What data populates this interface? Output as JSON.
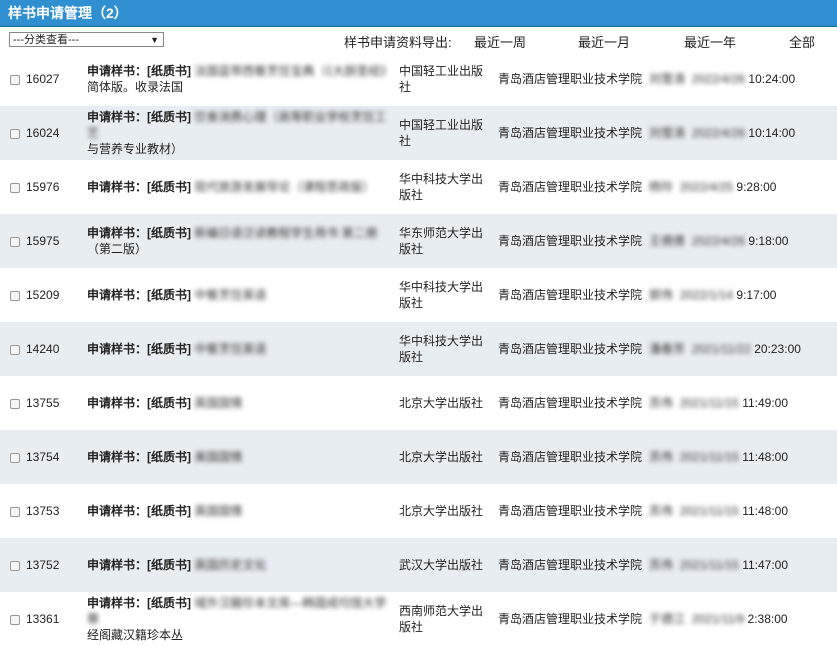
{
  "header": {
    "title": "样书申请管理（2）"
  },
  "toolbar": {
    "filter_value": "---分类查看---",
    "export_label": "样书申请资料导出:",
    "export_links": [
      "最近一周",
      "最近一月",
      "最近一年",
      "全部"
    ]
  },
  "rows": [
    {
      "id": "16027",
      "prefix": "申请样书：[纸质书]",
      "title": "法国蓝带西餐烹饪宝典（《大厨圣经》",
      "title2": "简体版。收录法国",
      "publisher": "中国轻工业出版社",
      "school": "青岛酒店管理职业技术学院",
      "person": "刘雪涛",
      "date": "2022/4/26",
      "time": "10:24:00"
    },
    {
      "id": "16024",
      "prefix": "申请样书：[纸质书]",
      "title": "饮食消费心理（高等职业学校烹饪工艺",
      "title2": "与营养专业教材）",
      "publisher": "中国轻工业出版社",
      "school": "青岛酒店管理职业技术学院",
      "person": "刘雪涛",
      "date": "2022/4/26",
      "time": "10:14:00"
    },
    {
      "id": "15976",
      "prefix": "申请样书：[纸质书]",
      "title": "现代旅游发展导论（课程思政版）",
      "title2": "",
      "publisher": "华中科技大学出版社",
      "school": "青岛酒店管理职业技术学院",
      "person": "杨玲",
      "date": "2022/4/25",
      "time": "9:28:00"
    },
    {
      "id": "15975",
      "prefix": "申请样书：[纸质书]",
      "title": "新编日语泛读教程学生用书 第二册",
      "title2": "（第二版）",
      "publisher": "华东师范大学出版社",
      "school": "青岛酒店管理职业技术学院",
      "person": "王倩倩",
      "date": "2022/4/26",
      "time": "9:18:00"
    },
    {
      "id": "15209",
      "prefix": "申请样书：[纸质书]",
      "title": "中餐烹饪英语",
      "title2": "",
      "publisher": "华中科技大学出版社",
      "school": "青岛酒店管理职业技术学院",
      "person": "郭伟",
      "date": "2022/1/14",
      "time": "9:17:00"
    },
    {
      "id": "14240",
      "prefix": "申请样书：[纸质书]",
      "title": "中餐烹饪英语",
      "title2": "",
      "publisher": "华中科技大学出版社",
      "school": "青岛酒店管理职业技术学院",
      "person": "潘春芳",
      "date": "2021/11/22",
      "time": "20:23:00"
    },
    {
      "id": "13755",
      "prefix": "申请样书：[纸质书]",
      "title": "英国国情",
      "title2": "",
      "publisher": "北京大学出版社",
      "school": "青岛酒店管理职业技术学院",
      "person": "苏伟",
      "date": "2021/11/15",
      "time": "11:49:00"
    },
    {
      "id": "13754",
      "prefix": "申请样书：[纸质书]",
      "title": "美国国情",
      "title2": "",
      "publisher": "北京大学出版社",
      "school": "青岛酒店管理职业技术学院",
      "person": "苏伟",
      "date": "2021/11/15",
      "time": "11:48:00"
    },
    {
      "id": "13753",
      "prefix": "申请样书：[纸质书]",
      "title": "英国国情",
      "title2": "",
      "publisher": "北京大学出版社",
      "school": "青岛酒店管理职业技术学院",
      "person": "苏伟",
      "date": "2021/11/15",
      "time": "11:48:00"
    },
    {
      "id": "13752",
      "prefix": "申请样书：[纸质书]",
      "title": "英国历史文化",
      "title2": "",
      "publisher": "武汉大学出版社",
      "school": "青岛酒店管理职业技术学院",
      "person": "苏伟",
      "date": "2021/11/15",
      "time": "11:47:00"
    },
    {
      "id": "13361",
      "prefix": "申请样书：[纸质书]",
      "title": "域外汉籍珍本文库—韩国成均馆大学尊",
      "title2": "经阁藏汉籍珍本丛",
      "publisher": "西南师范大学出版社",
      "school": "青岛酒店管理职业技术学院",
      "person": "于德江",
      "date": "2021/11/9",
      "time": "2:38:00"
    }
  ]
}
